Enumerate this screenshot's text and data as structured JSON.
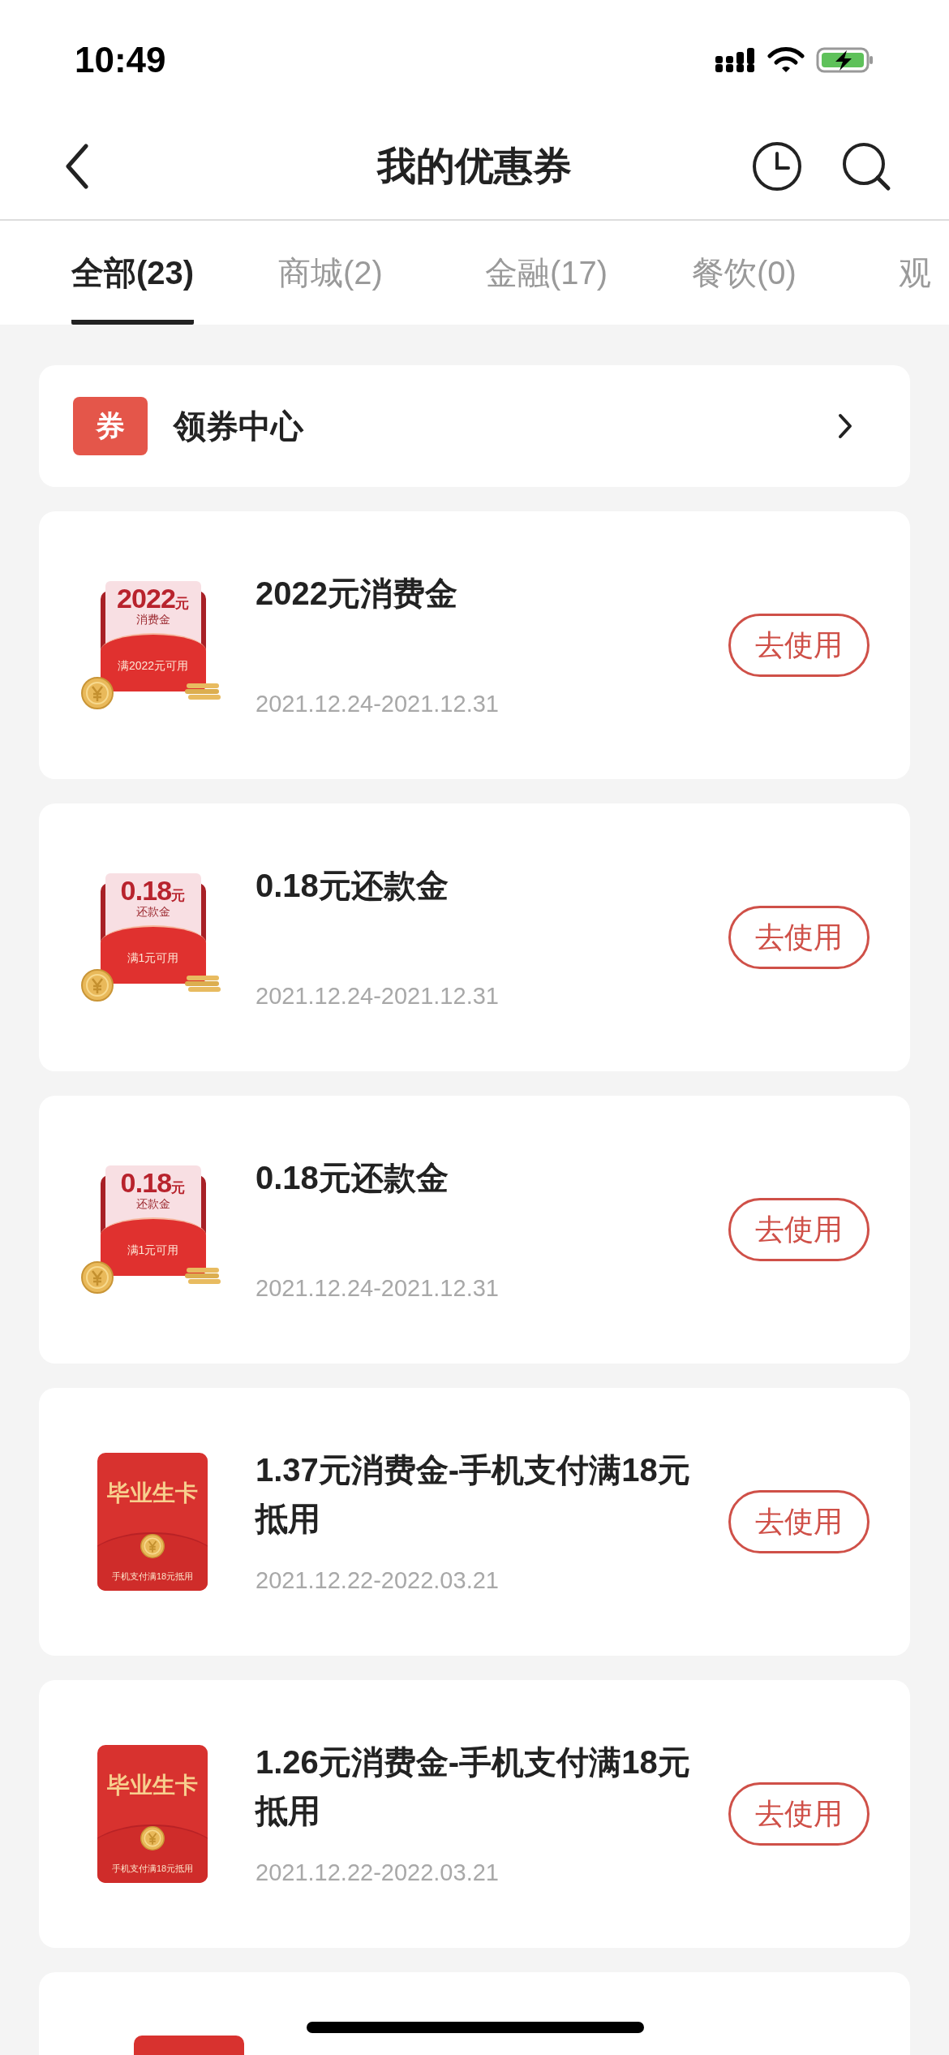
{
  "status_bar": {
    "time": "10:49"
  },
  "nav": {
    "title": "我的优惠券"
  },
  "tabs": [
    {
      "label": "全部(23)",
      "selected": true
    },
    {
      "label": "商城(2)",
      "selected": false
    },
    {
      "label": "金融(17)",
      "selected": false
    },
    {
      "label": "餐饮(0)",
      "selected": false
    },
    {
      "label": "观",
      "selected": false
    }
  ],
  "coupon_center": {
    "badge": "券",
    "label": "领券中心"
  },
  "coupons": [
    {
      "kind": "envelope",
      "art": {
        "amount": "2022",
        "unit": "元",
        "label": "消费金",
        "condition": "满2022元可用"
      },
      "title": "2022元消费金",
      "dates": "2021.12.24-2021.12.31",
      "action": "去使用"
    },
    {
      "kind": "envelope",
      "art": {
        "amount": "0.18",
        "unit": "元",
        "label": "还款金",
        "condition": "满1元可用"
      },
      "title": "0.18元还款金",
      "dates": "2021.12.24-2021.12.31",
      "action": "去使用"
    },
    {
      "kind": "envelope",
      "art": {
        "amount": "0.18",
        "unit": "元",
        "label": "还款金",
        "condition": "满1元可用"
      },
      "title": "0.18元还款金",
      "dates": "2021.12.24-2021.12.31",
      "action": "去使用"
    },
    {
      "kind": "card",
      "art": {
        "label": "毕业生卡",
        "condition": "手机支付满18元抵用"
      },
      "title": "1.37元消费金-手机支付满18元抵用",
      "dates": "2021.12.22-2022.03.21",
      "action": "去使用"
    },
    {
      "kind": "card",
      "art": {
        "label": "毕业生卡",
        "condition": "手机支付满18元抵用"
      },
      "title": "1.26元消费金-手机支付满18元抵用",
      "dates": "2021.12.22-2022.03.21",
      "action": "去使用"
    }
  ]
}
